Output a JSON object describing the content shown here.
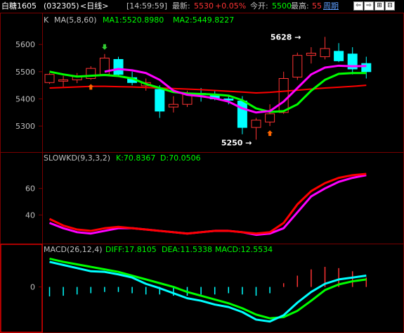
{
  "header": {
    "title": "白糖1605",
    "code": "(032305)",
    "period": "<日线>",
    "time": "[14:59:59]",
    "latest_label": "最新:",
    "latest_value": "5530",
    "change": "+0.05%",
    "open_label": "今开:",
    "open_value": "5500",
    "high_label": "最高:",
    "high_value": "55",
    "period_button": "周期"
  },
  "colors": {
    "up": "#ff3333",
    "down": "#00ffff",
    "ma1": "#ff00ff",
    "ma2": "#00ff00",
    "ma3": "#ff0000",
    "grid": "#7a0000",
    "axis_text": "#c0c0c0",
    "green_text": "#00ff00",
    "white": "#ffffff"
  },
  "main_panel": {
    "label": "K",
    "ma_label": "MA(5,8,60)",
    "ma1_text": "MA1:5520.8980",
    "ma2_text": "MA2:5449.8227",
    "high_annotation": "5628",
    "low_annotation": "5250",
    "ticks": [
      "5600",
      "5500",
      "5400",
      "5300"
    ]
  },
  "kd_panel": {
    "label": "SLOWKD(9,3,3,2)",
    "k_text": "K:70.8367",
    "d_text": "D:70.0506",
    "ticks": [
      "60",
      "40"
    ]
  },
  "macd_panel": {
    "label": "MACD(26,12,4)",
    "diff_text": "DIFF:17.8105",
    "dea_text": "DEA:11.5338",
    "macd_text": "MACD:12.5534",
    "ticks": [
      "0"
    ]
  },
  "chart_data": {
    "type": "candlestick",
    "price_axis": {
      "ticks": [
        5600,
        5500,
        5400,
        5300
      ],
      "range": [
        5220,
        5660
      ]
    },
    "candles": [
      {
        "o": 5460,
        "h": 5495,
        "l": 5455,
        "c": 5490
      },
      {
        "o": 5465,
        "h": 5485,
        "l": 5445,
        "c": 5470
      },
      {
        "o": 5470,
        "h": 5495,
        "l": 5458,
        "c": 5482
      },
      {
        "o": 5475,
        "h": 5520,
        "l": 5470,
        "c": 5512
      },
      {
        "o": 5490,
        "h": 5565,
        "l": 5485,
        "c": 5550
      },
      {
        "o": 5545,
        "h": 5555,
        "l": 5480,
        "c": 5490
      },
      {
        "o": 5478,
        "h": 5500,
        "l": 5450,
        "c": 5460
      },
      {
        "o": 5448,
        "h": 5475,
        "l": 5430,
        "c": 5460
      },
      {
        "o": 5435,
        "h": 5450,
        "l": 5330,
        "c": 5355
      },
      {
        "o": 5370,
        "h": 5410,
        "l": 5350,
        "c": 5380
      },
      {
        "o": 5380,
        "h": 5430,
        "l": 5370,
        "c": 5420
      },
      {
        "o": 5420,
        "h": 5440,
        "l": 5390,
        "c": 5415
      },
      {
        "o": 5412,
        "h": 5430,
        "l": 5395,
        "c": 5400
      },
      {
        "o": 5400,
        "h": 5415,
        "l": 5380,
        "c": 5395
      },
      {
        "o": 5392,
        "h": 5410,
        "l": 5270,
        "c": 5295
      },
      {
        "o": 5295,
        "h": 5330,
        "l": 5250,
        "c": 5322
      },
      {
        "o": 5315,
        "h": 5380,
        "l": 5300,
        "c": 5345
      },
      {
        "o": 5350,
        "h": 5500,
        "l": 5345,
        "c": 5475
      },
      {
        "o": 5480,
        "h": 5570,
        "l": 5470,
        "c": 5560
      },
      {
        "o": 5560,
        "h": 5590,
        "l": 5530,
        "c": 5568
      },
      {
        "o": 5555,
        "h": 5628,
        "l": 5545,
        "c": 5585
      },
      {
        "o": 5575,
        "h": 5605,
        "l": 5535,
        "c": 5540
      },
      {
        "o": 5565,
        "h": 5590,
        "l": 5490,
        "c": 5510
      },
      {
        "o": 5530,
        "h": 5555,
        "l": 5475,
        "c": 5500
      }
    ],
    "ma5": [
      null,
      null,
      null,
      null,
      5500,
      5510,
      5505,
      5495,
      5470,
      5430,
      5415,
      5410,
      5402,
      5390,
      5365,
      5350,
      5355,
      5390,
      5440,
      5490,
      5515,
      5522,
      5520,
      5521
    ],
    "ma8": [
      5500,
      5490,
      5482,
      5485,
      5488,
      5484,
      5475,
      5455,
      5440,
      5425,
      5420,
      5418,
      5416,
      5412,
      5395,
      5365,
      5352,
      5355,
      5380,
      5430,
      5470,
      5492,
      5495,
      5495
    ],
    "ma60": [
      5440,
      5442,
      5444,
      5446,
      5446,
      5445,
      5444,
      5442,
      5440,
      5438,
      5436,
      5434,
      5431,
      5428,
      5425,
      5422,
      5424,
      5428,
      5432,
      5436,
      5440,
      5443,
      5446,
      5450
    ],
    "kd": {
      "ticks": [
        60,
        40
      ],
      "range": [
        20,
        80
      ],
      "k": [
        37,
        32,
        29,
        28,
        30,
        31,
        30,
        29,
        28,
        27,
        26,
        27,
        28,
        28,
        27,
        26,
        27,
        34,
        48,
        58,
        64,
        68,
        70,
        71
      ],
      "d": [
        34,
        30,
        27,
        26,
        28,
        30,
        30,
        29,
        28,
        27,
        26,
        27,
        28,
        28,
        27,
        25,
        26,
        30,
        42,
        54,
        60,
        65,
        68,
        70
      ]
    },
    "macd": {
      "ticks": [
        0
      ],
      "range": [
        -70,
        50
      ],
      "diff": [
        40,
        35,
        30,
        25,
        24,
        20,
        15,
        5,
        -2,
        -10,
        -18,
        -22,
        -28,
        -32,
        -40,
        -52,
        -55,
        -45,
        -25,
        -8,
        5,
        12,
        15,
        18
      ],
      "dea": [
        45,
        40,
        36,
        32,
        28,
        24,
        18,
        12,
        6,
        0,
        -8,
        -14,
        -20,
        -26,
        -34,
        -44,
        -50,
        -48,
        -38,
        -22,
        -5,
        4,
        9,
        12
      ],
      "hist": [
        -15,
        -14,
        -12,
        -10,
        -8,
        -8,
        -10,
        -12,
        -12,
        -14,
        -14,
        -12,
        -12,
        -10,
        -12,
        -14,
        -10,
        6,
        18,
        28,
        32,
        30,
        25,
        15
      ]
    },
    "signals": [
      {
        "i": 3,
        "type": "buy"
      },
      {
        "i": 4,
        "type": "sell"
      },
      {
        "i": 16,
        "type": "buy"
      }
    ]
  }
}
